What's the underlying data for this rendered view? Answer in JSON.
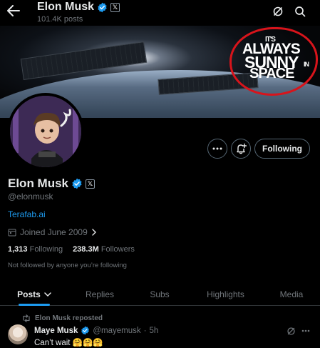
{
  "header": {
    "name": "Elon Musk",
    "posts_count": "101.4K posts",
    "x_badge": "𝕏"
  },
  "banner": {
    "text_line1": "IT'S",
    "text_line2": "ALWAYS",
    "text_line3": "SUNNY",
    "text_line4": "IN",
    "text_line5": "SPACE"
  },
  "profile": {
    "name": "Elon Musk",
    "x_badge": "𝕏",
    "handle": "@elonmusk",
    "website": "Terafab.ai",
    "joined": "Joined June 2009",
    "following_count": "1,313",
    "following_label": "Following",
    "followers_count": "238.3M",
    "followers_label": "Followers",
    "not_followed": "Not followed by anyone you’re following"
  },
  "actions": {
    "following_button": "Following"
  },
  "tabs": [
    {
      "label": "Posts",
      "active": true
    },
    {
      "label": "Replies"
    },
    {
      "label": "Subs"
    },
    {
      "label": "Highlights"
    },
    {
      "label": "Media"
    }
  ],
  "post": {
    "repost_label": "Elon Musk reposted",
    "author_name": "Maye Musk",
    "author_handle": "@mayemusk",
    "separator": "·",
    "time": "5h",
    "text": "Can’t wait 🤗🤗🤗"
  },
  "colors": {
    "accent": "#1d9bf0",
    "verified": "#1d9bf0",
    "muted": "#71767b",
    "circle": "#d8141b"
  }
}
